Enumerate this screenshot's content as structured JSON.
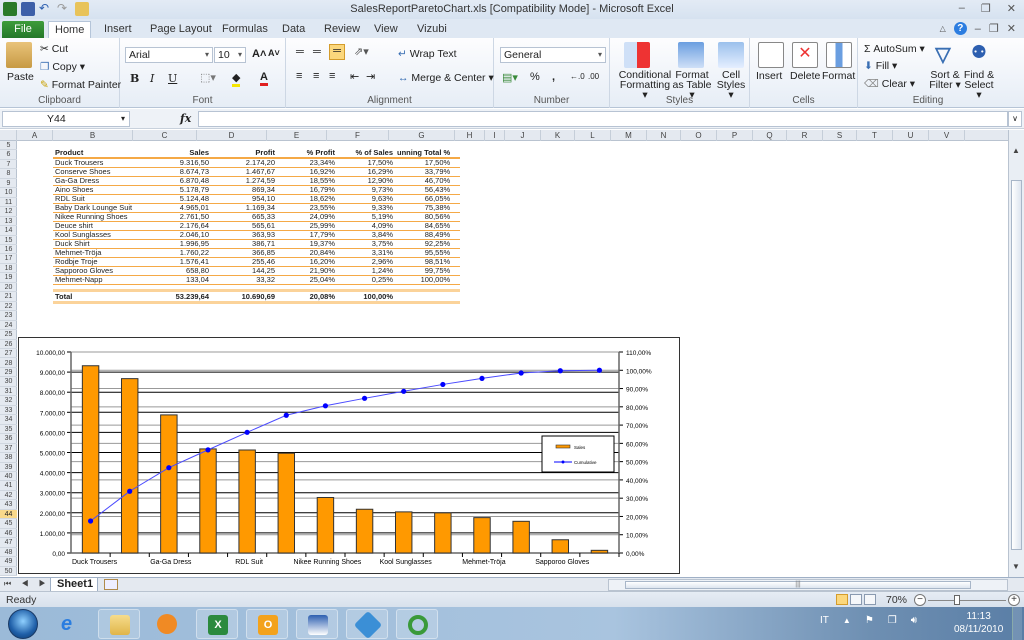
{
  "window": {
    "title": "SalesReportParetoChart.xls  [Compatibility Mode]  -  Microsoft Excel",
    "minimize": "‒",
    "restore": "❐",
    "close": "✕"
  },
  "ribbon_tabs": [
    "File",
    "Home",
    "Insert",
    "Page Layout",
    "Formulas",
    "Data",
    "Review",
    "View",
    "Vizubi"
  ],
  "ribbon": {
    "clipboard": {
      "label": "Clipboard",
      "paste": "Paste",
      "cut": "Cut",
      "copy": "Copy ▾",
      "format_painter": "Format Painter"
    },
    "font": {
      "label": "Font",
      "font_name": "Arial",
      "font_size": "10",
      "grow": "A˄",
      "shrink": "A˅",
      "bold": "B",
      "italic": "I",
      "underline": "U",
      "font_color_accent": "#e02020",
      "highlight_accent": "#f5e500"
    },
    "alignment": {
      "label": "Alignment",
      "wrap_text": "Wrap Text",
      "merge_center": "Merge & Center ▾"
    },
    "number": {
      "label": "Number",
      "format": "General",
      "percent": "%",
      "comma": ",",
      "inc_decimal": "+.0 .00",
      "dec_decimal": ".00 →.0"
    },
    "styles": {
      "label": "Styles",
      "conditional_formatting": "Conditional Formatting ▾",
      "format_as_table": "Format as Table ▾",
      "cell_styles": "Cell Styles ▾"
    },
    "cells": {
      "label": "Cells",
      "insert": "Insert",
      "delete": "Delete",
      "format": "Format"
    },
    "editing": {
      "label": "Editing",
      "autosum": "Σ AutoSum ▾",
      "fill": "Fill ▾",
      "clear": "Clear ▾",
      "sort_filter": "Sort & Filter ▾",
      "find_select": "Find & Select ▾"
    }
  },
  "formula_bar": {
    "name_box": "Y44",
    "fx": "fx",
    "formula": ""
  },
  "columns": [
    "A",
    "B",
    "C",
    "D",
    "E",
    "F",
    "G",
    "H",
    "I",
    "J",
    "K",
    "L",
    "M",
    "N",
    "O",
    "P",
    "Q",
    "R",
    "S",
    "T",
    "U",
    "V"
  ],
  "rows": [
    "5",
    "6",
    "7",
    "8",
    "9",
    "10",
    "11",
    "12",
    "13",
    "14",
    "15",
    "16",
    "17",
    "18",
    "19",
    "20",
    "21",
    "22",
    "23",
    "24",
    "25",
    "26",
    "27",
    "28",
    "29",
    "30",
    "31",
    "32",
    "33",
    "34",
    "35",
    "36",
    "37",
    "38",
    "39",
    "40",
    "41",
    "42",
    "43",
    "44",
    "45",
    "46",
    "47",
    "48",
    "49",
    "50"
  ],
  "selected_row": "44",
  "table": {
    "headers": [
      "Product",
      "Sales",
      "Profit",
      "% Profit",
      "% of Sales",
      "unning Total %"
    ],
    "rows": [
      [
        "Duck Trousers",
        "9.316,50",
        "2.174,20",
        "23,34%",
        "17,50%",
        "17,50%"
      ],
      [
        "Conserve Shoes",
        "8.674,73",
        "1.467,67",
        "16,92%",
        "16,29%",
        "33,79%"
      ],
      [
        "Ga-Ga Dress",
        "6.870,48",
        "1.274,59",
        "18,55%",
        "12,90%",
        "46,70%"
      ],
      [
        "Aino Shoes",
        "5.178,79",
        "869,34",
        "16,79%",
        "9,73%",
        "56,43%"
      ],
      [
        "RDL Suit",
        "5.124,48",
        "954,10",
        "18,62%",
        "9,63%",
        "66,05%"
      ],
      [
        "Baby Dark Lounge Suit",
        "4.965,01",
        "1.169,34",
        "23,55%",
        "9,33%",
        "75,38%"
      ],
      [
        "Nikee Running Shoes",
        "2.761,50",
        "665,33",
        "24,09%",
        "5,19%",
        "80,56%"
      ],
      [
        "Deuce shirt",
        "2.176,64",
        "565,61",
        "25,99%",
        "4,09%",
        "84,65%"
      ],
      [
        "Kool Sunglasses",
        "2.046,10",
        "363,93",
        "17,79%",
        "3,84%",
        "88,49%"
      ],
      [
        "Duck Shirt",
        "1.996,95",
        "386,71",
        "19,37%",
        "3,75%",
        "92,25%"
      ],
      [
        "Mehmet-Tröja",
        "1.760,22",
        "366,85",
        "20,84%",
        "3,31%",
        "95,55%"
      ],
      [
        "Rodbje Troje",
        "1.576,41",
        "255,46",
        "16,20%",
        "2,96%",
        "98,51%"
      ],
      [
        "Sapporoo Gloves",
        "658,80",
        "144,25",
        "21,90%",
        "1,24%",
        "99,75%"
      ],
      [
        "Mehmet-Napp",
        "133,04",
        "33,32",
        "25,04%",
        "0,25%",
        "100,00%"
      ]
    ],
    "total": [
      "Total",
      "53.239,64",
      "10.690,69",
      "20,08%",
      "100,00%",
      ""
    ],
    "accent": "#f5a946"
  },
  "chart_data": {
    "type": "bar",
    "title": "",
    "categories": [
      "Duck Trousers",
      "Conserve Shoes",
      "Ga-Ga Dress",
      "Aino Shoes",
      "RDL Suit",
      "Baby Dark Lounge Suit",
      "Nikee Running Shoes",
      "Deuce shirt",
      "Kool Sunglasses",
      "Duck Shirt",
      "Mehmet-Tröja",
      "Rodbje Troje",
      "Sapporoo Gloves",
      "Mehmet-Napp"
    ],
    "visible_category_labels": [
      "Duck Trousers",
      "",
      "Ga-Ga Dress",
      "",
      "RDL  Suit",
      "",
      "Nikee Running Shoes",
      "",
      "Kool Sunglasses",
      "",
      "Mehmet-Tröja",
      "",
      "Sapporoo Gloves",
      ""
    ],
    "series": [
      {
        "name": "Sales",
        "type": "bar",
        "axis": "left",
        "color": "#ff9900",
        "values": [
          9316.5,
          8674.73,
          6870.48,
          5178.79,
          5124.48,
          4965.01,
          2761.5,
          2176.64,
          2046.1,
          1996.95,
          1760.22,
          1576.41,
          658.8,
          133.04
        ]
      },
      {
        "name": "Cumulative",
        "type": "line",
        "axis": "right",
        "color": "#0000ff",
        "values": [
          17.5,
          33.79,
          46.7,
          56.43,
          66.05,
          75.38,
          80.56,
          84.65,
          88.49,
          92.25,
          95.55,
          98.51,
          99.75,
          100.0
        ]
      }
    ],
    "y_left": {
      "min": 0,
      "max": 10000,
      "step": 1000,
      "tick_labels": [
        "0,00",
        "1.000,00",
        "2.000,00",
        "3.000,00",
        "4.000,00",
        "5.000,00",
        "6.000,00",
        "7.000,00",
        "8.000,00",
        "9.000,00",
        "10.000,00"
      ]
    },
    "y_right": {
      "min": 0,
      "max": 110,
      "step": 10,
      "tick_labels": [
        "0,00%",
        "10,00%",
        "20,00%",
        "30,00%",
        "40,00%",
        "50,00%",
        "60,00%",
        "70,00%",
        "80,00%",
        "90,00%",
        "100,00%",
        "110,00%"
      ]
    },
    "grid": true,
    "legend": {
      "position": "right",
      "entries": [
        "Sales",
        "Cumulative"
      ]
    },
    "xlabel": "",
    "ylabel": ""
  },
  "sheet_tabs": {
    "active": "Sheet1",
    "nav": "⏮ ◀ ▶ ⏭"
  },
  "status": {
    "ready": "Ready",
    "zoom": "70%",
    "zoom_fraction": 0.7
  },
  "taskbar": {
    "apps": [
      "internet-explorer",
      "windows-explorer",
      "media-player",
      "excel",
      "outlook",
      "paint",
      "vizubi",
      "qlikview"
    ],
    "language": "IT",
    "time": "11:13",
    "date": "08/11/2010"
  }
}
